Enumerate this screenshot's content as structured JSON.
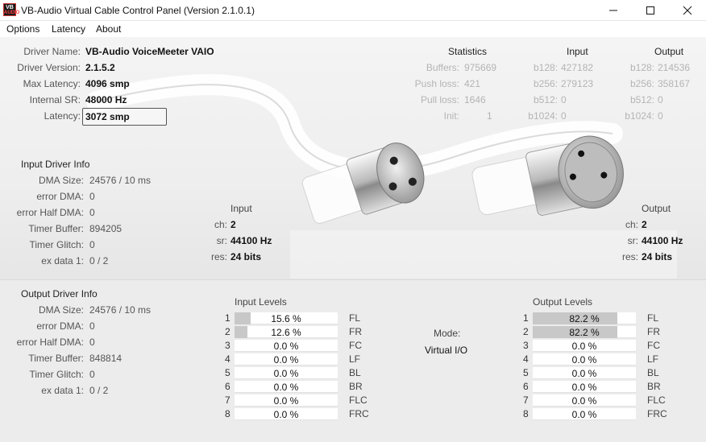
{
  "window": {
    "title": "VB-Audio Virtual Cable Control Panel (Version 2.1.0.1)",
    "icon_text_top": "VB",
    "icon_text_bottom": "AUDIO",
    "icon": "vb-audio-logo-icon"
  },
  "menu": [
    "Options",
    "Latency",
    "About"
  ],
  "driver": {
    "name_label": "Driver Name:",
    "name": "VB-Audio VoiceMeeter VAIO",
    "version_label": "Driver Version:",
    "version": "2.1.5.2",
    "max_latency_label": "Max Latency:",
    "max_latency": "4096 smp",
    "internal_sr_label": "Internal SR:",
    "internal_sr": "48000 Hz",
    "latency_label": "Latency:",
    "latency": "3072 smp"
  },
  "statistics": {
    "title": "Statistics",
    "input_title": "Input",
    "output_title": "Output",
    "rows": [
      {
        "label": "Buffers:",
        "value": "975669",
        "in_label": "b128:",
        "in_value": "427182",
        "out_label": "b128:",
        "out_value": "214536"
      },
      {
        "label": "Push loss:",
        "value": "421",
        "in_label": "b256:",
        "in_value": "279123",
        "out_label": "b256:",
        "out_value": "358167"
      },
      {
        "label": "Pull loss:",
        "value": "1646",
        "in_label": "b512:",
        "in_value": "0",
        "out_label": "b512:",
        "out_value": "0"
      },
      {
        "label": "Init:",
        "value": "1",
        "in_label": "b1024:",
        "in_value": "0",
        "out_label": "b1024:",
        "out_value": "0"
      }
    ]
  },
  "input_driver_info": {
    "title": "Input Driver Info",
    "rows": [
      {
        "label": "DMA Size:",
        "value": "24576 / 10 ms"
      },
      {
        "label": "error DMA:",
        "value": "0"
      },
      {
        "label": "error Half DMA:",
        "value": "0"
      },
      {
        "label": "Timer Buffer:",
        "value": "894205"
      },
      {
        "label": "Timer Glitch:",
        "value": "0"
      },
      {
        "label": "ex data 1:",
        "value": "0 / 2"
      }
    ]
  },
  "output_driver_info": {
    "title": "Output Driver Info",
    "rows": [
      {
        "label": "DMA Size:",
        "value": "24576 / 10 ms"
      },
      {
        "label": "error DMA:",
        "value": "0"
      },
      {
        "label": "error Half DMA:",
        "value": "0"
      },
      {
        "label": "Timer Buffer:",
        "value": "848814"
      },
      {
        "label": "Timer Glitch:",
        "value": "0"
      },
      {
        "label": "ex data 1:",
        "value": "0 / 2"
      }
    ]
  },
  "input_format": {
    "title": "Input",
    "ch_label": "ch:",
    "ch": "2",
    "sr_label": "sr:",
    "sr": "44100 Hz",
    "res_label": "res:",
    "res": "24 bits"
  },
  "output_format": {
    "title": "Output",
    "ch_label": "ch:",
    "ch": "2",
    "sr_label": "sr:",
    "sr": "44100 Hz",
    "res_label": "res:",
    "res": "24 bits"
  },
  "mode": {
    "label": "Mode:",
    "value": "Virtual I/O"
  },
  "input_levels": {
    "title": "Input Levels",
    "channels": [
      {
        "num": "1",
        "text": "15.6 %",
        "level": 0.156,
        "name": "FL"
      },
      {
        "num": "2",
        "text": "12.6 %",
        "level": 0.126,
        "name": "FR"
      },
      {
        "num": "3",
        "text": "0.0 %",
        "level": 0,
        "name": "FC"
      },
      {
        "num": "4",
        "text": "0.0 %",
        "level": 0,
        "name": "LF"
      },
      {
        "num": "5",
        "text": "0.0 %",
        "level": 0,
        "name": "BL"
      },
      {
        "num": "6",
        "text": "0.0 %",
        "level": 0,
        "name": "BR"
      },
      {
        "num": "7",
        "text": "0.0 %",
        "level": 0,
        "name": "FLC"
      },
      {
        "num": "8",
        "text": "0.0 %",
        "level": 0,
        "name": "FRC"
      }
    ]
  },
  "output_levels": {
    "title": "Output Levels",
    "channels": [
      {
        "num": "1",
        "text": "82.2 %",
        "level": 0.822,
        "name": "FL"
      },
      {
        "num": "2",
        "text": "82.2 %",
        "level": 0.822,
        "name": "FR"
      },
      {
        "num": "3",
        "text": "0.0 %",
        "level": 0,
        "name": "FC"
      },
      {
        "num": "4",
        "text": "0.0 %",
        "level": 0,
        "name": "LF"
      },
      {
        "num": "5",
        "text": "0.0 %",
        "level": 0,
        "name": "BL"
      },
      {
        "num": "6",
        "text": "0.0 %",
        "level": 0,
        "name": "BR"
      },
      {
        "num": "7",
        "text": "0.0 %",
        "level": 0,
        "name": "FLC"
      },
      {
        "num": "8",
        "text": "0.0 %",
        "level": 0,
        "name": "FRC"
      }
    ]
  }
}
